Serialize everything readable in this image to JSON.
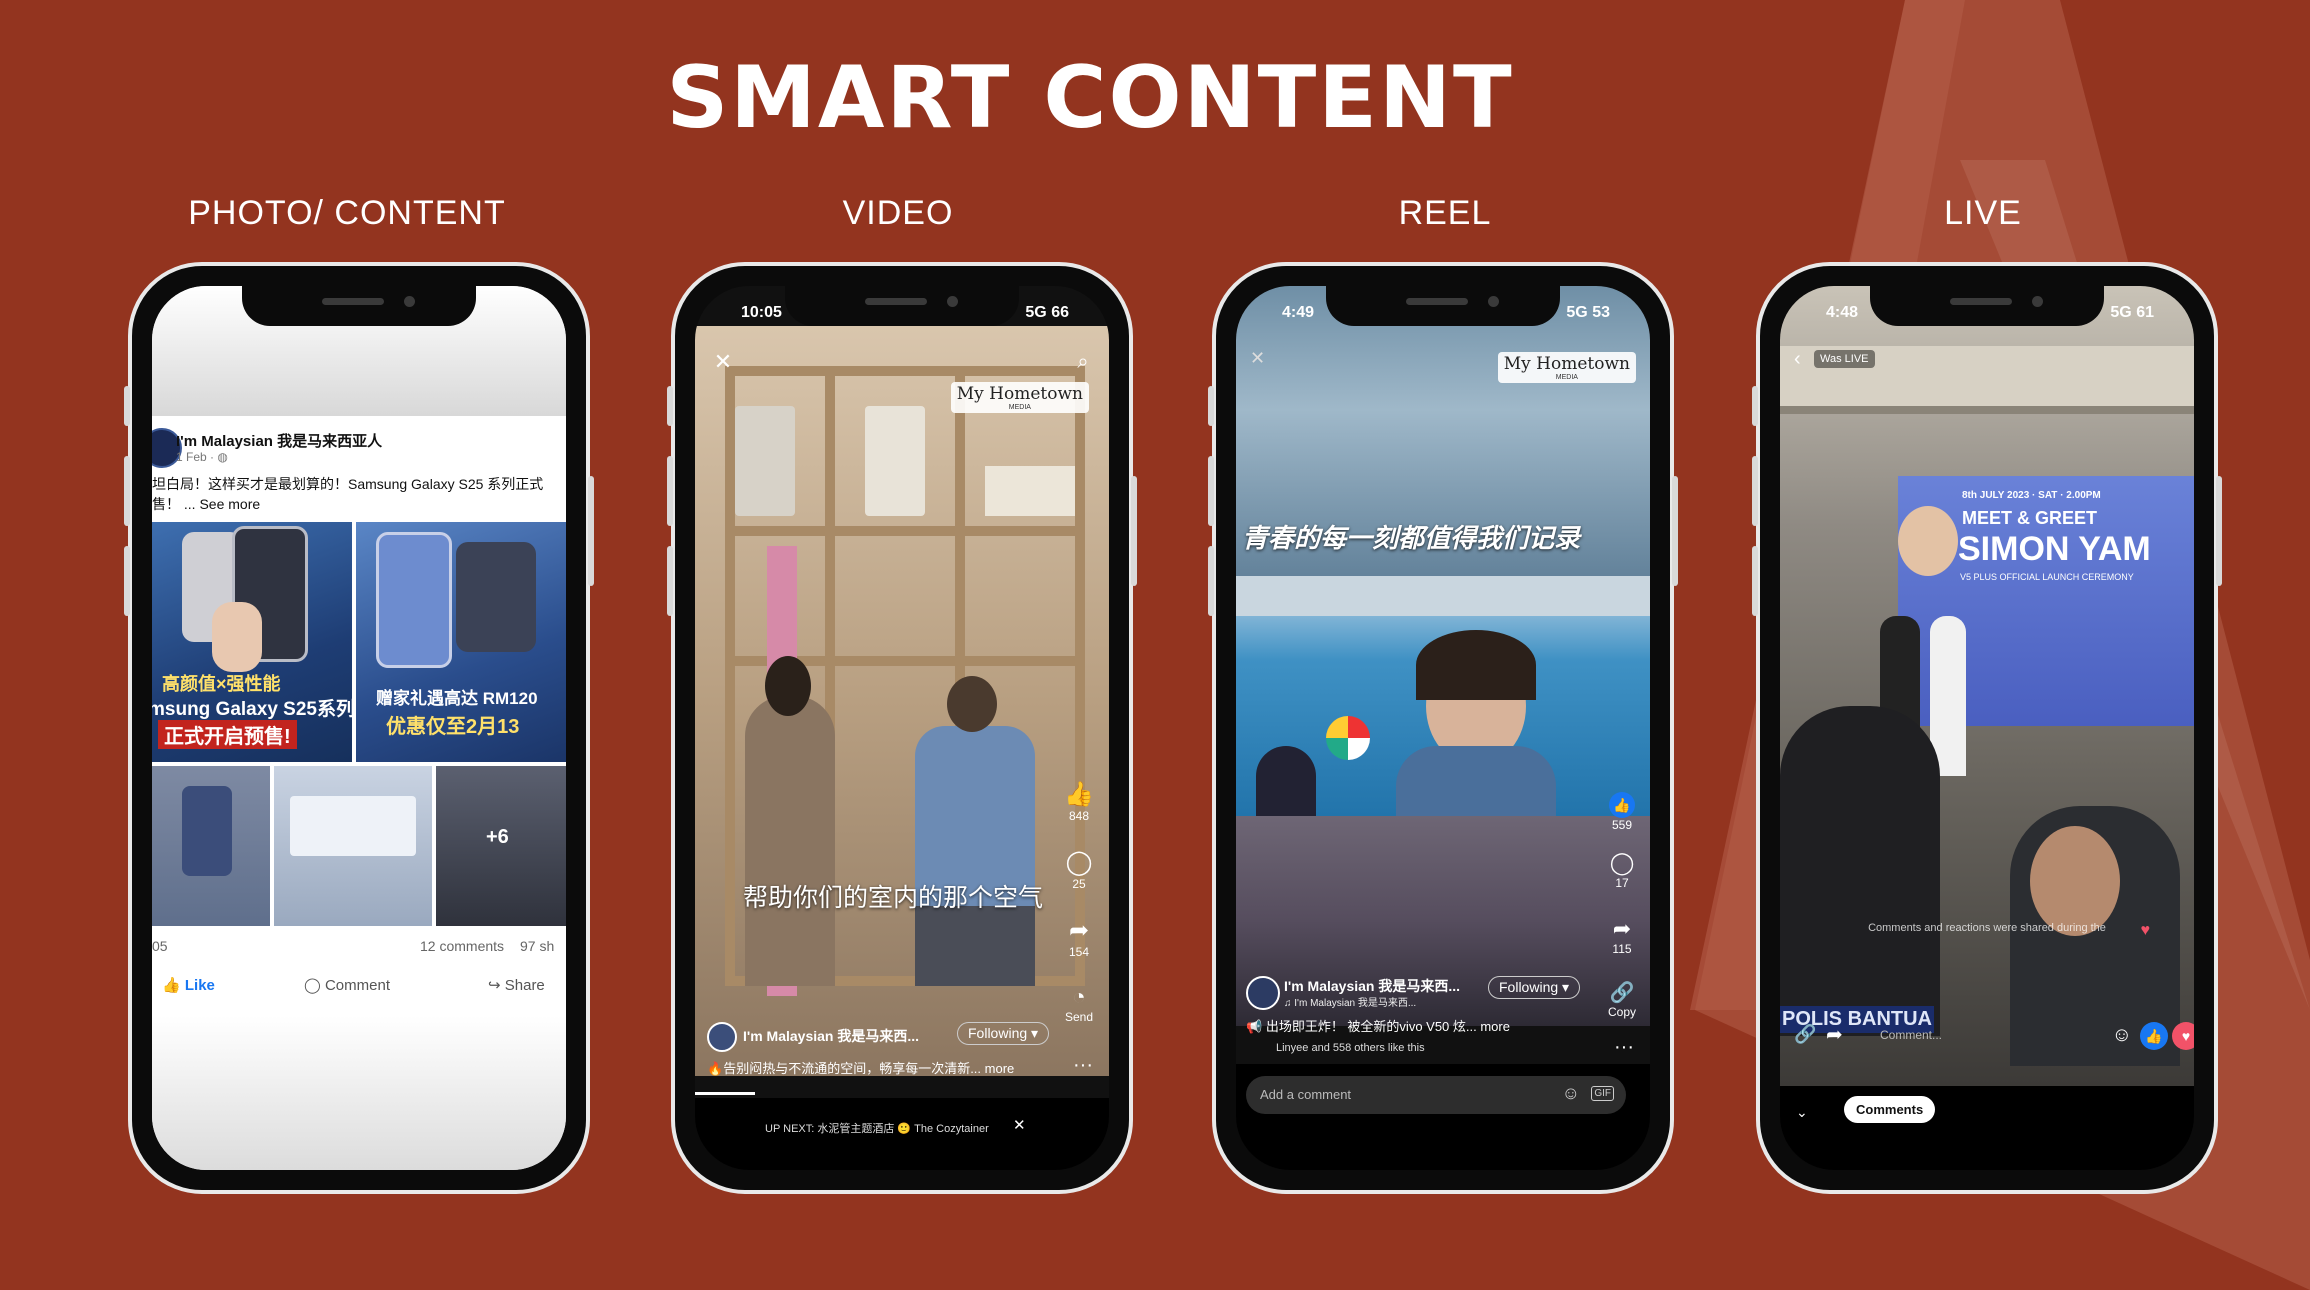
{
  "slide_title": "SMART CONTENT",
  "categories": [
    "PHOTO/ CONTENT",
    "VIDEO",
    "REEL",
    "LIVE"
  ],
  "photo_post": {
    "page_name": "I'm Malaysian 我是马来西亚人",
    "date": "1 Feb · ",
    "caption_line1": "坦白局！这样买才是最划算的！Samsung Galaxy S25 系列正式",
    "caption_line2": "售！ ... See more",
    "img1_line1": "高颜值×强性能",
    "img1_line2": "msung Galaxy S25系列",
    "img1_line3": "正式开启预售!",
    "img2_line1": "赠家礼遇高达 RM120",
    "img2_line2": "优惠仅至2月13",
    "more_photos": "+6",
    "stat_left": "05",
    "stat_comments": "12 comments",
    "stat_shares": "97 sh",
    "like": "Like",
    "comment": "Comment",
    "share": "Share"
  },
  "video_post": {
    "time": "10:05",
    "network": "5G 66",
    "brand": "My Hometown",
    "brand_sub": "MEDIA",
    "subtitle": "帮助你们的室内的那个空气",
    "likes": "848",
    "comments": "25",
    "shares": "154",
    "send": "Send",
    "page_name": "I'm Malaysian 我是马来西...",
    "following": "Following",
    "caption": "告别闷热与不流通的空间，畅享每一次清新... more",
    "up_next": "UP NEXT: 水泥管主题酒店 🙂 The Cozytainer"
  },
  "reel_post": {
    "time": "4:49",
    "network": "5G 53",
    "brand": "My Hometown",
    "brand_sub": "MEDIA",
    "overlay_text": "青春的每一刻都值得我们记录",
    "likes": "559",
    "comments": "17",
    "shares": "115",
    "copy": "Copy",
    "page_name": "I'm Malaysian 我是马来西...",
    "sub_name": "I'm Malaysian 我是马来西...",
    "following": "Following",
    "caption": "出场即王炸！ 被全新的vivo V50 炫... more",
    "liked_by": "Linyee and 558 others like this",
    "add_comment": "Add a comment",
    "gif": "GIF"
  },
  "live_post": {
    "time": "4:48",
    "network": "5G 61",
    "was_live": "Was LIVE",
    "banner_date": "8th JULY 2023 · SAT · 2.00PM",
    "banner_line1": "MEET & GREET",
    "banner_line2": "SIMON YAM",
    "banner_line3": "V5 PLUS OFFICIAL LAUNCH CEREMONY",
    "notice": "Comments and reactions were shared during the",
    "notice2": "were shared during the",
    "police": "POLIS BANTUA",
    "comment_placeholder": "Comment...",
    "comments_button": "Comments"
  },
  "colors": {
    "background": "#93341f",
    "facebook_blue": "#1877f2"
  }
}
